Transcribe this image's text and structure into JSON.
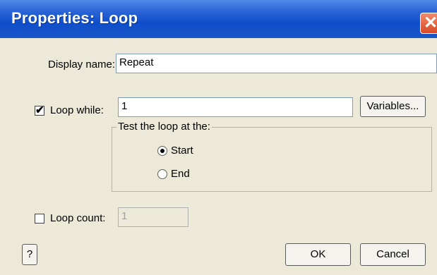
{
  "window": {
    "title": "Properties: Loop",
    "close_glyph": "✕"
  },
  "display_name": {
    "label": "Display name:",
    "value": "Repeat"
  },
  "loop_while": {
    "label": "Loop while:",
    "checked": true,
    "value": "1"
  },
  "variables_button": {
    "label": "Variables..."
  },
  "test_group": {
    "title": "Test the loop at the:",
    "options": [
      {
        "label": "Start",
        "selected": true
      },
      {
        "label": "End",
        "selected": false
      }
    ]
  },
  "loop_count": {
    "label": "Loop count:",
    "checked": false,
    "value": "1"
  },
  "buttons": {
    "help": "?",
    "ok": "OK",
    "cancel": "Cancel"
  },
  "icons": {
    "checkbox_check": "✔"
  }
}
